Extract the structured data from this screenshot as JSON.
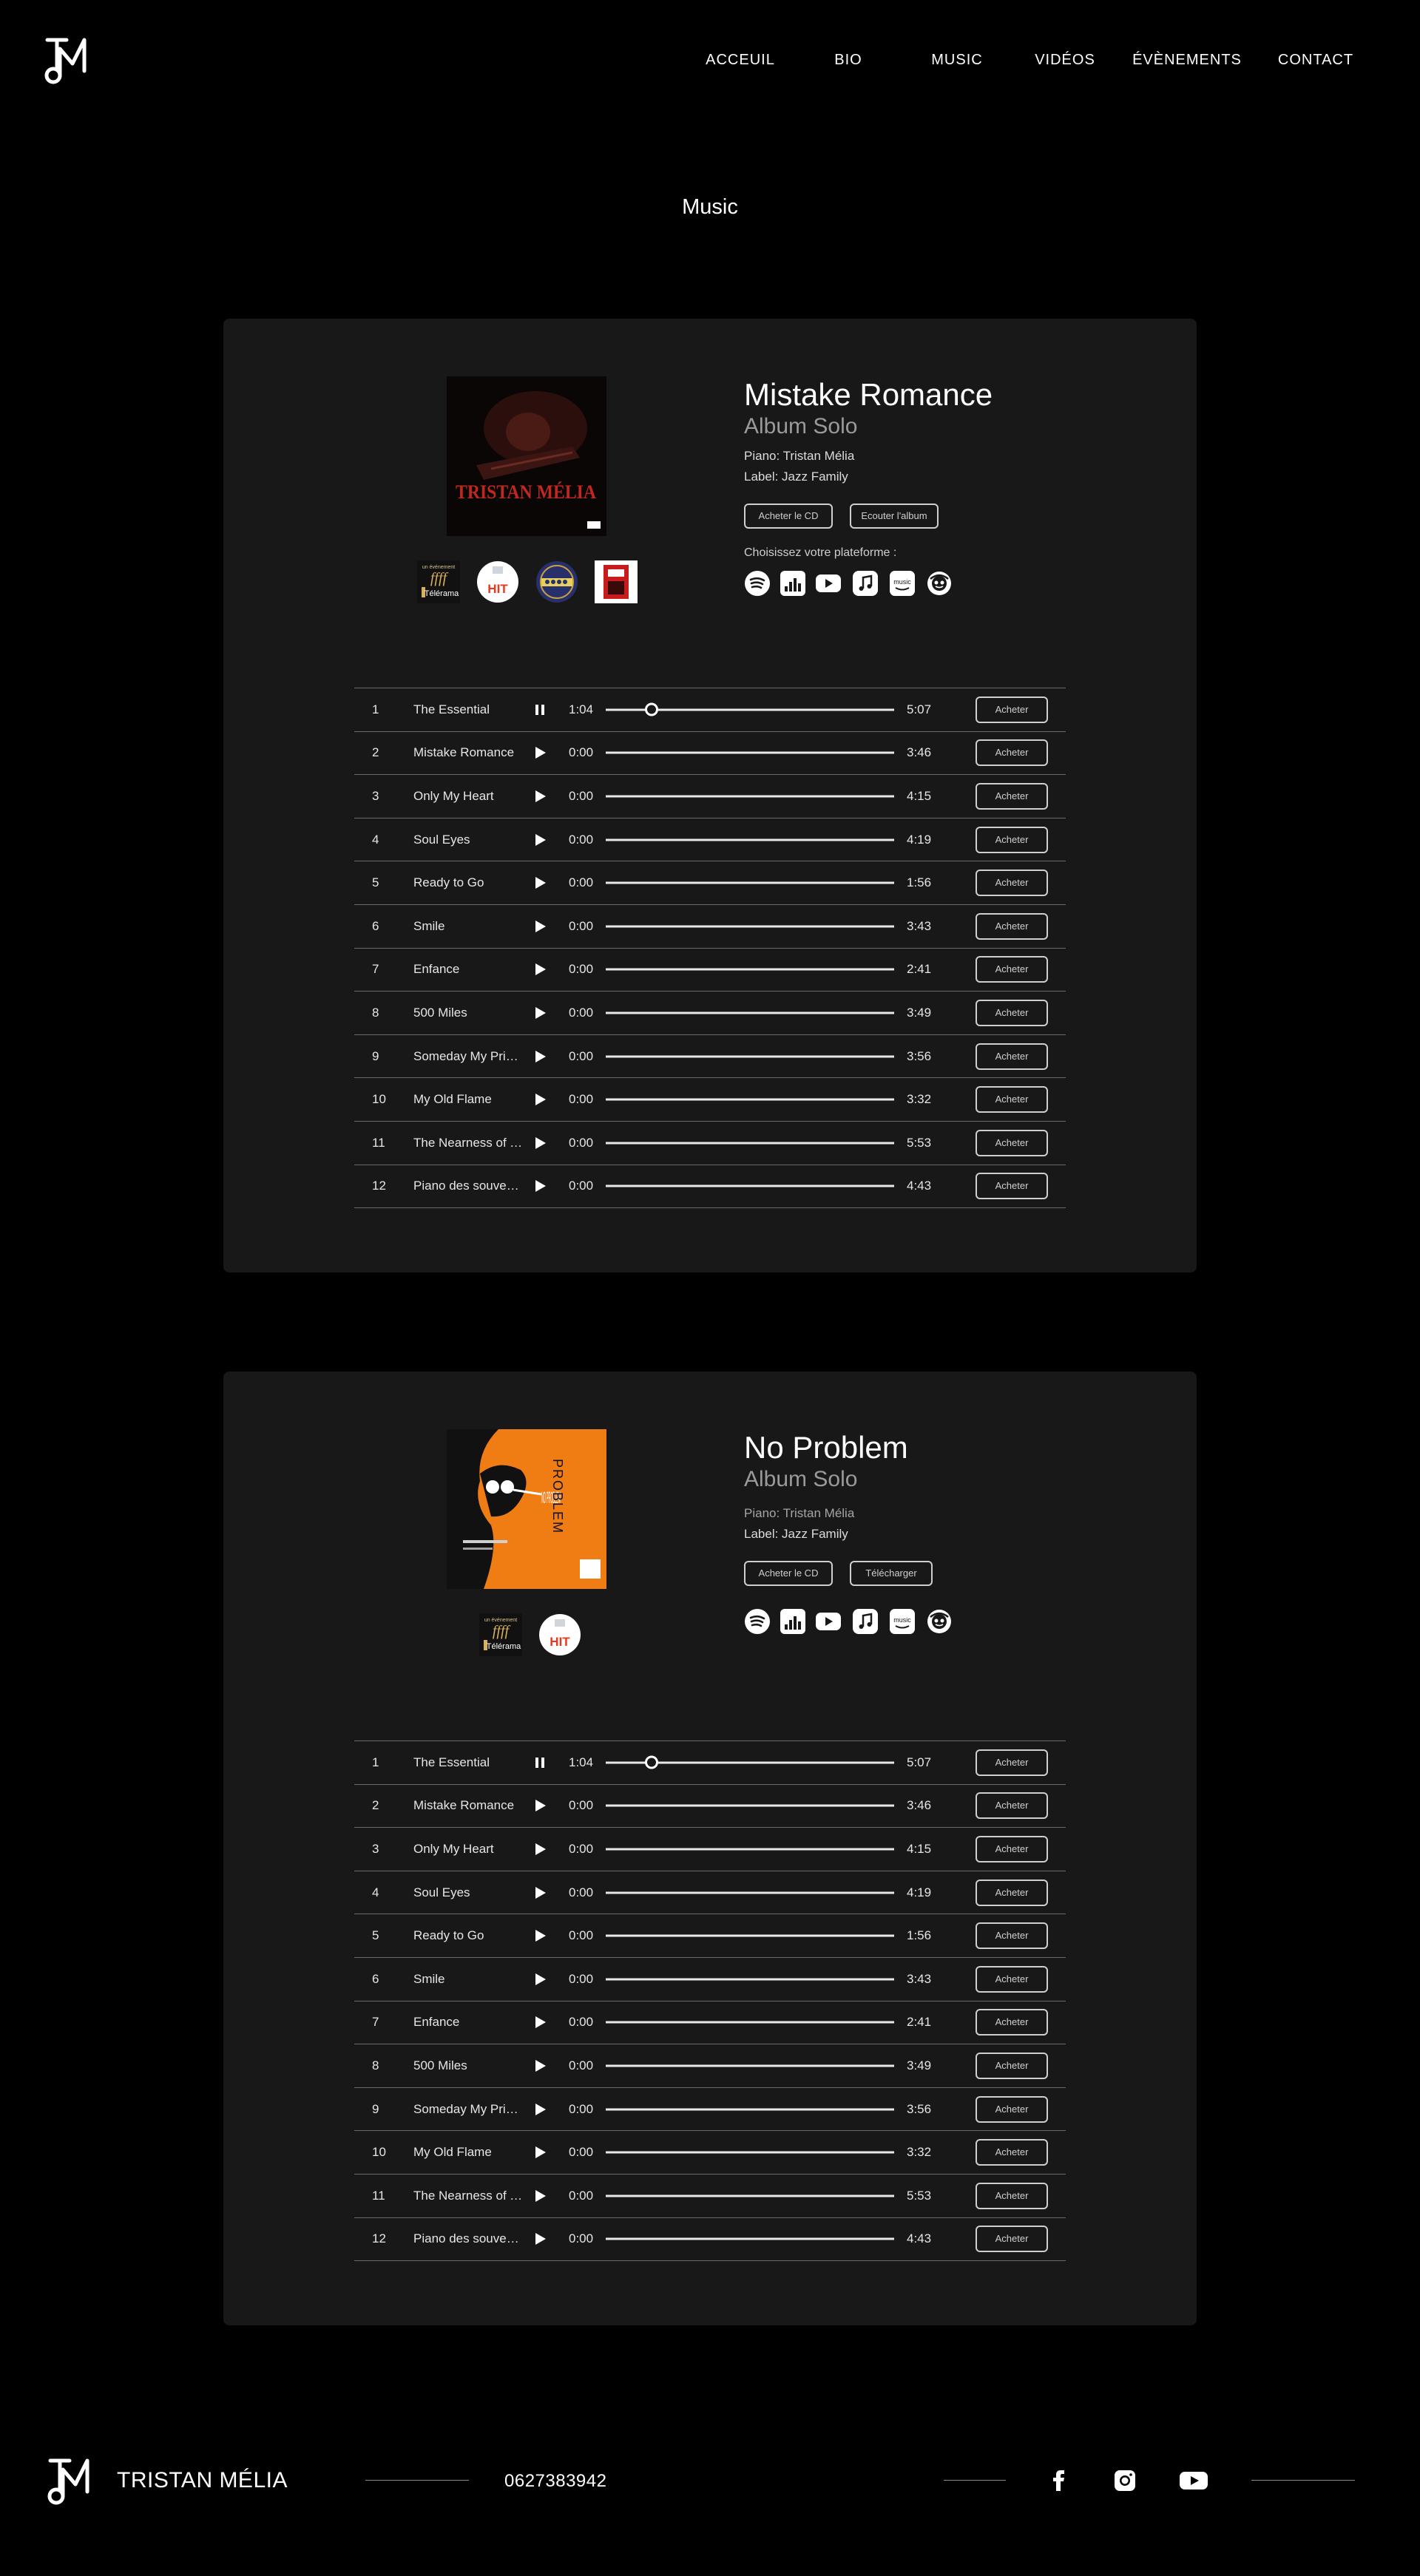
{
  "header": {
    "nav": [
      {
        "label": "ACCEUIL"
      },
      {
        "label": "BIO"
      },
      {
        "label": "MUSIC"
      },
      {
        "label": "VIDÉOS"
      },
      {
        "label": "ÉVÈNEMENTS"
      },
      {
        "label": "CONTACT"
      }
    ]
  },
  "page": {
    "title": "Music"
  },
  "albums": [
    {
      "title": "Mistake Romance",
      "subtitle": "Album Solo",
      "piano": "Piano: Tristan Mélia",
      "label": "Label: Jazz Family",
      "cover_text": "TRISTAN MÉLIA",
      "buttons": [
        {
          "label": "Acheter le CD"
        },
        {
          "label": "Ecouter l'album"
        }
      ],
      "platform_label": "Choisissez votre plateforme :",
      "awards": [
        "telerama-ffff-icon",
        "hit-award-icon",
        "jazz-badge-icon",
        "magazine-badge-icon"
      ],
      "award_texts": {
        "telerama_top": "un événement",
        "telerama": "Télérama",
        "hit": "HIT"
      },
      "platforms": [
        "spotify-icon",
        "deezer-icon",
        "youtube-icon",
        "apple-music-icon",
        "amazon-music-icon",
        "napster-icon"
      ],
      "tracks": [
        {
          "num": "1",
          "name": "The Essential",
          "current": "1:04",
          "duration": "5:07",
          "buy": "Acheter",
          "state": "playing",
          "progress": 0.16
        },
        {
          "num": "2",
          "name": "Mistake Romance",
          "current": "0:00",
          "duration": "3:46",
          "buy": "Acheter",
          "state": "paused",
          "progress": 0
        },
        {
          "num": "3",
          "name": "Only My Heart",
          "current": "0:00",
          "duration": "4:15",
          "buy": "Acheter",
          "state": "paused",
          "progress": 0
        },
        {
          "num": "4",
          "name": "Soul Eyes",
          "current": "0:00",
          "duration": "4:19",
          "buy": "Acheter",
          "state": "paused",
          "progress": 0
        },
        {
          "num": "5",
          "name": "Ready to Go",
          "current": "0:00",
          "duration": "1:56",
          "buy": "Acheter",
          "state": "paused",
          "progress": 0
        },
        {
          "num": "6",
          "name": "Smile",
          "current": "0:00",
          "duration": "3:43",
          "buy": "Acheter",
          "state": "paused",
          "progress": 0
        },
        {
          "num": "7",
          "name": "Enfance",
          "current": "0:00",
          "duration": "2:41",
          "buy": "Acheter",
          "state": "paused",
          "progress": 0
        },
        {
          "num": "8",
          "name": "500 Miles",
          "current": "0:00",
          "duration": "3:49",
          "buy": "Acheter",
          "state": "paused",
          "progress": 0
        },
        {
          "num": "9",
          "name": "Someday My Prin…",
          "current": "0:00",
          "duration": "3:56",
          "buy": "Acheter",
          "state": "paused",
          "progress": 0
        },
        {
          "num": "10",
          "name": "My Old Flame",
          "current": "0:00",
          "duration": "3:32",
          "buy": "Acheter",
          "state": "paused",
          "progress": 0
        },
        {
          "num": "11",
          "name": "The Nearness of You",
          "current": "0:00",
          "duration": "5:53",
          "buy": "Acheter",
          "state": "paused",
          "progress": 0
        },
        {
          "num": "12",
          "name": "Piano des souvenirs",
          "current": "0:00",
          "duration": "4:43",
          "buy": "Acheter",
          "state": "paused",
          "progress": 0
        }
      ]
    },
    {
      "title": "No Problem",
      "subtitle": "Album Solo",
      "piano": "Piano: Tristan Mélia",
      "label": "Label: Jazz Family",
      "cover_text": "NO PROBLEM",
      "buttons": [
        {
          "label": "Acheter le CD"
        },
        {
          "label": "Télécharger"
        }
      ],
      "awards": [
        "telerama-ffff-icon",
        "hit-award-icon"
      ],
      "award_texts": {
        "telerama_top": "un événement",
        "telerama": "Télérama",
        "hit": "HIT"
      },
      "platforms": [
        "spotify-icon",
        "deezer-icon",
        "youtube-icon",
        "apple-music-icon",
        "amazon-music-icon",
        "napster-icon"
      ],
      "tracks": [
        {
          "num": "1",
          "name": "The Essential",
          "current": "1:04",
          "duration": "5:07",
          "buy": "Acheter",
          "state": "playing",
          "progress": 0.16
        },
        {
          "num": "2",
          "name": "Mistake Romance",
          "current": "0:00",
          "duration": "3:46",
          "buy": "Acheter",
          "state": "paused",
          "progress": 0
        },
        {
          "num": "3",
          "name": "Only My Heart",
          "current": "0:00",
          "duration": "4:15",
          "buy": "Acheter",
          "state": "paused",
          "progress": 0
        },
        {
          "num": "4",
          "name": "Soul Eyes",
          "current": "0:00",
          "duration": "4:19",
          "buy": "Acheter",
          "state": "paused",
          "progress": 0
        },
        {
          "num": "5",
          "name": "Ready to Go",
          "current": "0:00",
          "duration": "1:56",
          "buy": "Acheter",
          "state": "paused",
          "progress": 0
        },
        {
          "num": "6",
          "name": "Smile",
          "current": "0:00",
          "duration": "3:43",
          "buy": "Acheter",
          "state": "paused",
          "progress": 0
        },
        {
          "num": "7",
          "name": "Enfance",
          "current": "0:00",
          "duration": "2:41",
          "buy": "Acheter",
          "state": "paused",
          "progress": 0
        },
        {
          "num": "8",
          "name": "500 Miles",
          "current": "0:00",
          "duration": "3:49",
          "buy": "Acheter",
          "state": "paused",
          "progress": 0
        },
        {
          "num": "9",
          "name": "Someday My Prin…",
          "current": "0:00",
          "duration": "3:56",
          "buy": "Acheter",
          "state": "paused",
          "progress": 0
        },
        {
          "num": "10",
          "name": "My Old Flame",
          "current": "0:00",
          "duration": "3:32",
          "buy": "Acheter",
          "state": "paused",
          "progress": 0
        },
        {
          "num": "11",
          "name": "The Nearness of You",
          "current": "0:00",
          "duration": "5:53",
          "buy": "Acheter",
          "state": "paused",
          "progress": 0
        },
        {
          "num": "12",
          "name": "Piano des souvenirs",
          "current": "0:00",
          "duration": "4:43",
          "buy": "Acheter",
          "state": "paused",
          "progress": 0
        }
      ]
    }
  ],
  "footer": {
    "name": "TRISTAN MÉLIA",
    "phone": "0627383942",
    "social": [
      "facebook-icon",
      "instagram-icon",
      "youtube-icon"
    ]
  },
  "colors": {
    "background": "#000000",
    "card": "#181818",
    "accent_orange": "#f07c14",
    "cover_red": "#c0281e"
  }
}
